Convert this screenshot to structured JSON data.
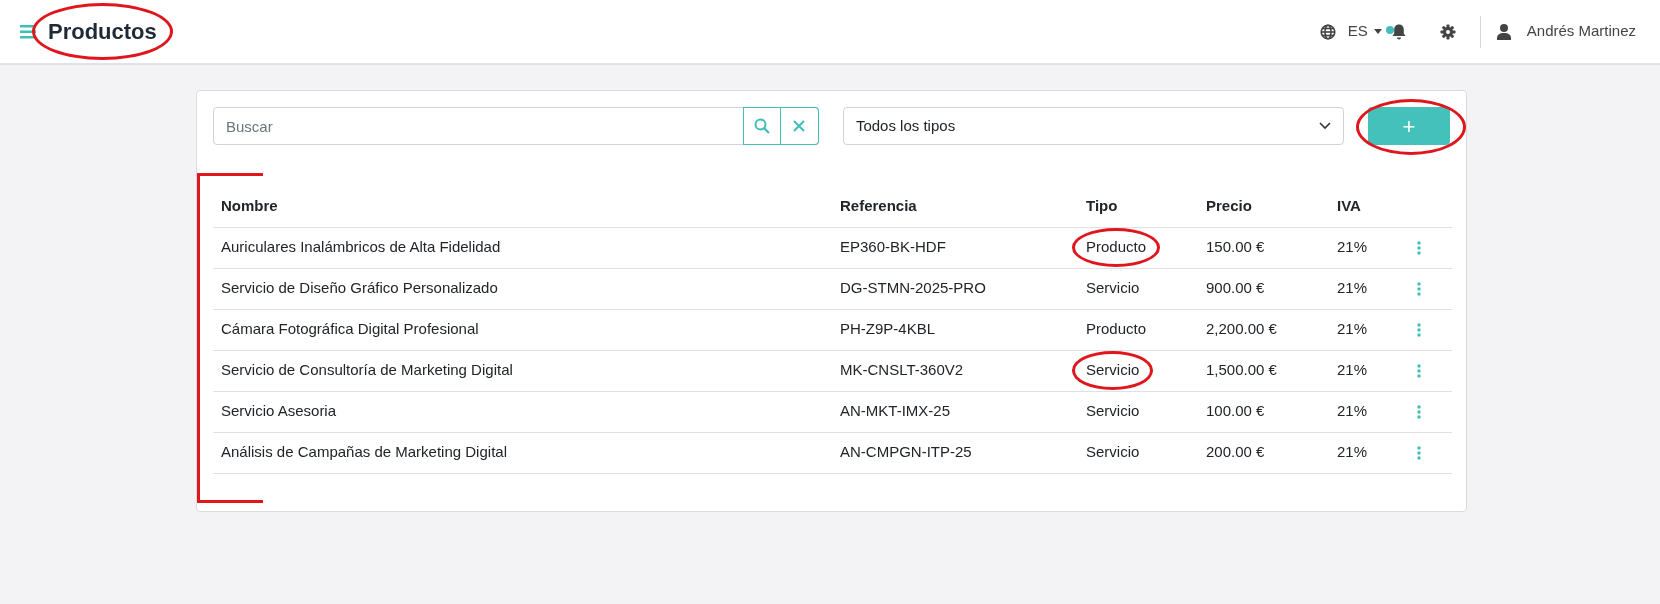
{
  "header": {
    "title": "Productos",
    "title_circled": true,
    "language": "ES",
    "notification_dot": true,
    "user": "Andrés Martinez"
  },
  "toolbar": {
    "search": {
      "placeholder": "Buscar"
    },
    "type_filter": {
      "value": "Todos los tipos"
    },
    "add_button": {
      "label": "+",
      "circled": true
    }
  },
  "table": {
    "bracketed": true,
    "columns": [
      "Nombre",
      "Referencia",
      "Tipo",
      "Precio",
      "IVA"
    ],
    "rows": [
      {
        "cells": [
          "Auriculares Inalámbricos de Alta Fidelidad",
          "EP360-BK-HDF",
          "Producto",
          "150.00 €",
          "21%"
        ],
        "tipo_circled": true
      },
      {
        "cells": [
          "Servicio de Diseño Gráfico Personalizado",
          "DG-STMN-2025-PRO",
          "Servicio",
          "900.00 €",
          "21%"
        ],
        "tipo_circled": false
      },
      {
        "cells": [
          "Cámara Fotográfica Digital Profesional",
          "PH-Z9P-4KBL",
          "Producto",
          "2,200.00 €",
          "21%"
        ],
        "tipo_circled": false
      },
      {
        "cells": [
          "Servicio de Consultoría de Marketing Digital",
          "MK-CNSLT-360V2",
          "Servicio",
          "1,500.00 €",
          "21%"
        ],
        "tipo_circled": true
      },
      {
        "cells": [
          "Servicio Asesoria",
          "AN-MKT-IMX-25",
          "Servicio",
          "100.00 €",
          "21%"
        ],
        "tipo_circled": false
      },
      {
        "cells": [
          "Análisis de Campañas de Marketing Digital",
          "AN-CMPGN-ITP-25",
          "Servicio",
          "200.00 €",
          "21%"
        ],
        "tipo_circled": false
      }
    ]
  }
}
